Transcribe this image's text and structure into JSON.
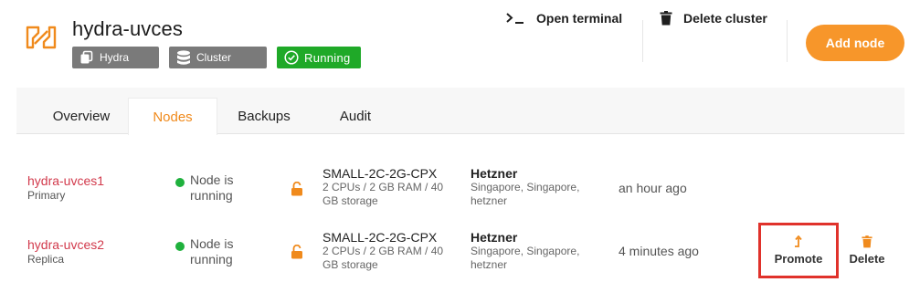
{
  "header": {
    "title": "hydra-uvces",
    "badges": {
      "hydra": "Hydra",
      "cluster": "Cluster",
      "running": "Running"
    },
    "actions": {
      "open_terminal": "Open terminal",
      "delete_cluster": "Delete cluster",
      "add_node": "Add node"
    }
  },
  "tabs": [
    {
      "label": "Overview"
    },
    {
      "label": "Nodes",
      "active": true
    },
    {
      "label": "Backups"
    },
    {
      "label": "Audit"
    }
  ],
  "nodes": [
    {
      "name": "hydra-uvces1",
      "role": "Primary",
      "status": "Node is running",
      "plan": "SMALL-2C-2G-CPX",
      "plan_spec": "2 CPUs / 2 GB RAM / 40 GB storage",
      "provider": "Hetzner",
      "location": "Singapore, Singapore, hetzner",
      "created": "an hour ago"
    },
    {
      "name": "hydra-uvces2",
      "role": "Replica",
      "status": "Node is running",
      "plan": "SMALL-2C-2G-CPX",
      "plan_spec": "2 CPUs / 2 GB RAM / 40 GB storage",
      "provider": "Hetzner",
      "location": "Singapore, Singapore, hetzner",
      "created": "4 minutes ago",
      "actions": {
        "promote": "Promote",
        "delete": "Delete"
      }
    }
  ],
  "colors": {
    "accent": "#f7962a",
    "running": "#1fa928",
    "node_name": "#d23a4c",
    "highlight_border": "#e0322b",
    "badge_gray": "#7a7a7a"
  }
}
